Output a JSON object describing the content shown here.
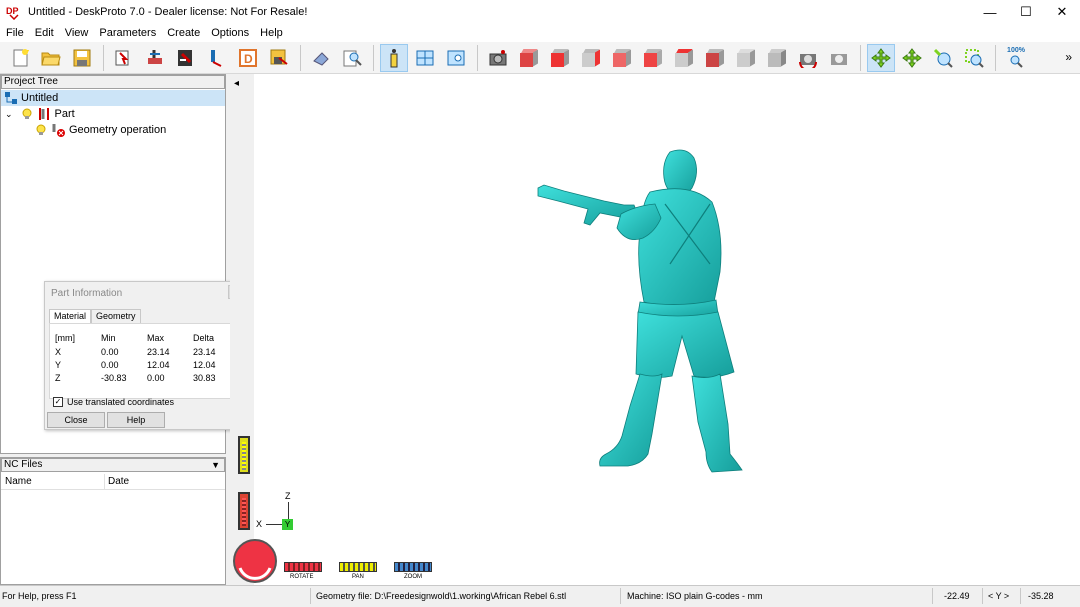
{
  "window": {
    "title": "Untitled - DeskProto 7.0 - Dealer license: Not For Resale!",
    "icon_text": "DP",
    "minimize": "—",
    "maximize": "☐",
    "close": "✕"
  },
  "menu": [
    "File",
    "Edit",
    "View",
    "Parameters",
    "Create",
    "Options",
    "Help"
  ],
  "toolbar": {
    "zoom_label": "100%",
    "overflow": "»"
  },
  "project_tree": {
    "header": "Project Tree",
    "root": "Untitled",
    "part": "Part",
    "operation": "Geometry operation"
  },
  "nc_files": {
    "header": "NC Files",
    "columns": [
      "Name",
      "Date"
    ]
  },
  "part_information": {
    "title": "Part Information",
    "tabs": [
      "Material",
      "Geometry"
    ],
    "active_tab": "Material",
    "headers": [
      "[mm]",
      "Min",
      "Max",
      "Delta"
    ],
    "rows": [
      {
        "axis": "X",
        "min": "0.00",
        "max": "23.14",
        "delta": "23.14"
      },
      {
        "axis": "Y",
        "min": "0.00",
        "max": "12.04",
        "delta": "12.04"
      },
      {
        "axis": "Z",
        "min": "-30.83",
        "max": "0.00",
        "delta": "30.83"
      }
    ],
    "checkbox_label": "Use translated coordinates",
    "checkbox_checked": true,
    "close_label": "Close",
    "help_label": "Help"
  },
  "viewport": {
    "model_color": "#26c7c4",
    "axes": {
      "x": "X",
      "y": "Y",
      "z": "Z"
    },
    "controls": [
      "ROTATE",
      "PAN",
      "ZOOM"
    ],
    "collapse_arrow": "◂"
  },
  "status": {
    "help": "For Help, press F1",
    "geometry": "Geometry file: D:\\Freedesignwold\\1.working\\African Rebel 6.stl",
    "machine": "Machine: ISO plain G-codes - mm",
    "x": "-22.49",
    "axis": "< Y >",
    "y": "-35.28"
  }
}
